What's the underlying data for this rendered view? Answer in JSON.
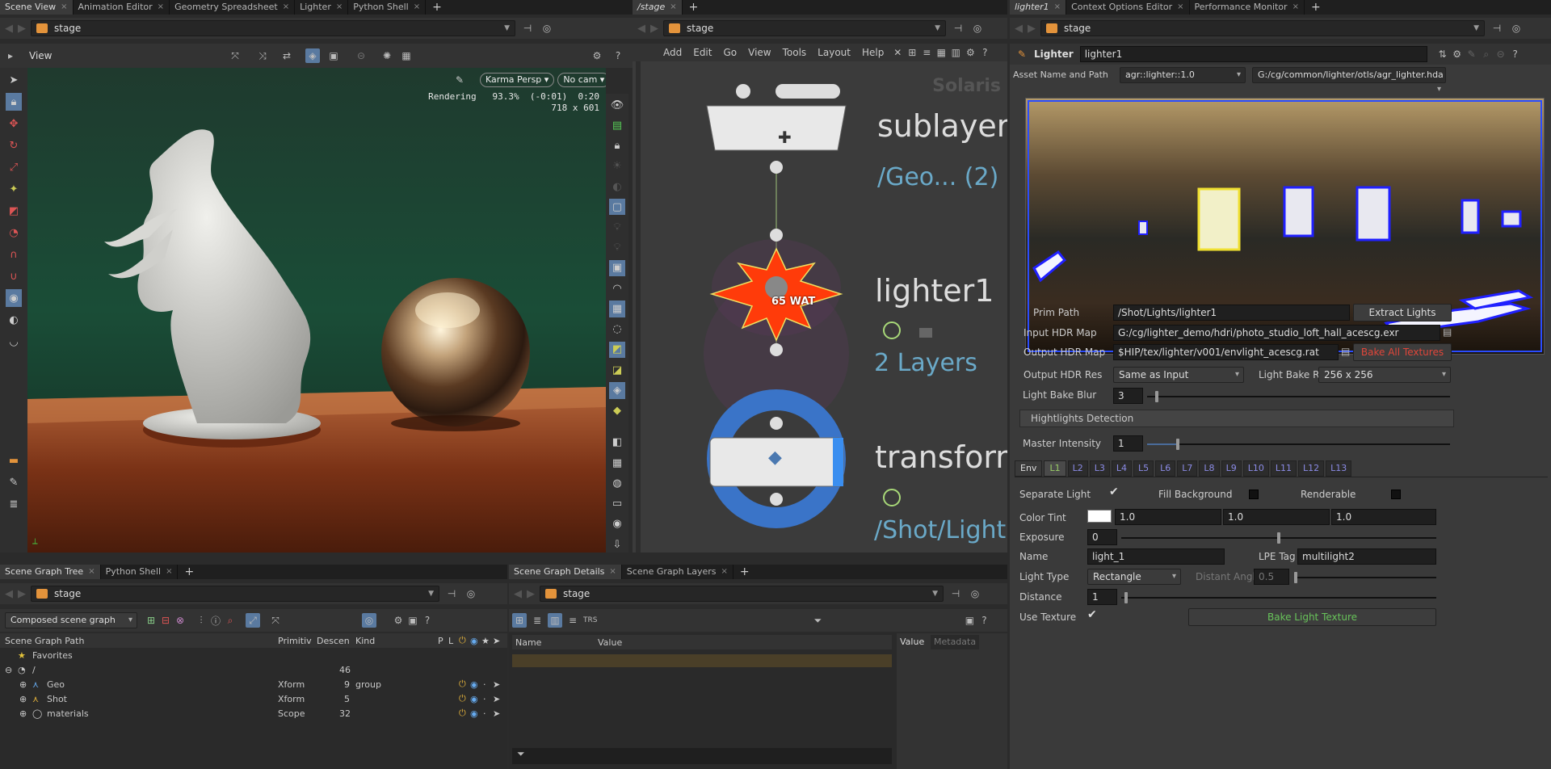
{
  "left_tabs": [
    "Scene View",
    "Animation Editor",
    "Geometry Spreadsheet",
    "Lighter",
    "Python Shell"
  ],
  "mid_tabs": [
    "/stage"
  ],
  "right_tabs": [
    "lighter1",
    "Context Options Editor",
    "Performance Monitor"
  ],
  "path_label": "stage",
  "viewport": {
    "view_label": "View",
    "camera_menu": "Karma Persp",
    "cam_menu": "No cam",
    "render_status": "Rendering   93.3%  (-0:01)  0:20",
    "resolution": "718 x 601"
  },
  "network": {
    "menu": [
      "Add",
      "Edit",
      "Go",
      "View",
      "Tools",
      "Layout",
      "Help"
    ],
    "context_label": "Solaris",
    "nodes": {
      "sublayer_name": "sublayer",
      "sublayer_sub": "/Geo... (2)",
      "lighter_name": "lighter1",
      "lighter_badge": "65 WAT",
      "lighter_sub": "2 Layers",
      "transform_name": "transform",
      "transform_sub": "/Shot/Light"
    }
  },
  "params": {
    "node_type": "Lighter",
    "node_name": "lighter1",
    "asset_label": "Asset Name and Path",
    "asset_name": "agr::lighter::1.0",
    "asset_path": "G:/cg/common/lighter/otls/agr_lighter.hda",
    "prim_path_label": "Prim Path",
    "prim_path": "/Shot/Lights/lighter1",
    "extract_button": "Extract Lights",
    "input_hdr_label": "Input HDR Map",
    "input_hdr": "G:/cg/lighter_demo/hdri/photo_studio_loft_hall_acescg.exr",
    "output_hdr_label": "Output HDR Map",
    "output_hdr": "$HIP/tex/lighter/v001/envlight_acescg.rat",
    "bake_all_button": "Bake All Textures",
    "output_res_label": "Output HDR Res",
    "output_res": "Same as Input",
    "bake_res_label": "Light Bake Res",
    "bake_res": "256 x 256",
    "blur_label": "Light Bake Blur",
    "blur": "3",
    "highlights_label": "Hightlights Detection",
    "master_label": "Master Intensity",
    "master": "1",
    "light_tabs": [
      "Env",
      "L1",
      "L2",
      "L3",
      "L4",
      "L5",
      "L6",
      "L7",
      "L8",
      "L9",
      "L10",
      "L11",
      "L12",
      "L13"
    ],
    "separate_label": "Separate Light",
    "fill_bg_label": "Fill Background",
    "renderable_label": "Renderable",
    "tint_label": "Color Tint",
    "tint": [
      "1.0",
      "1.0",
      "1.0"
    ],
    "exposure_label": "Exposure",
    "exposure": "0",
    "name_label": "Name",
    "name": "light_1",
    "lpe_label": "LPE Tag",
    "lpe": "multilight2",
    "type_label": "Light Type",
    "type": "Rectangle",
    "distant_label": "Distant Angle",
    "distant": "0.5",
    "distance_label": "Distance",
    "distance": "1",
    "texture_label": "Use Texture",
    "bake_texture_button": "Bake Light Texture"
  },
  "tree": {
    "tabs": [
      "Scene Graph Tree",
      "Python Shell"
    ],
    "composed": "Composed scene graph",
    "headers": [
      "Scene Graph Path",
      "Primitiv",
      "Descen",
      "Kind",
      "P",
      "L"
    ],
    "rows": [
      {
        "name": "Favorites",
        "type": "",
        "desc": "",
        "kind": ""
      },
      {
        "name": "/",
        "type": "",
        "desc": "46",
        "kind": ""
      },
      {
        "name": "Geo",
        "type": "Xform",
        "desc": "9",
        "kind": "group"
      },
      {
        "name": "Shot",
        "type": "Xform",
        "desc": "5",
        "kind": ""
      },
      {
        "name": "materials",
        "type": "Scope",
        "desc": "32",
        "kind": ""
      }
    ]
  },
  "details": {
    "tabs": [
      "Scene Graph Details",
      "Scene Graph Layers"
    ],
    "headers": [
      "Name",
      "Value"
    ],
    "side_tabs": [
      "Value",
      "Metadata"
    ],
    "trs": "TRS"
  },
  "colors": {
    "accent_orange": "#e3933b",
    "node_red": "#ff3b0a",
    "blue_node": "#3a74c8",
    "bake_red": "#e0463a",
    "bake_green": "#68c45a"
  }
}
